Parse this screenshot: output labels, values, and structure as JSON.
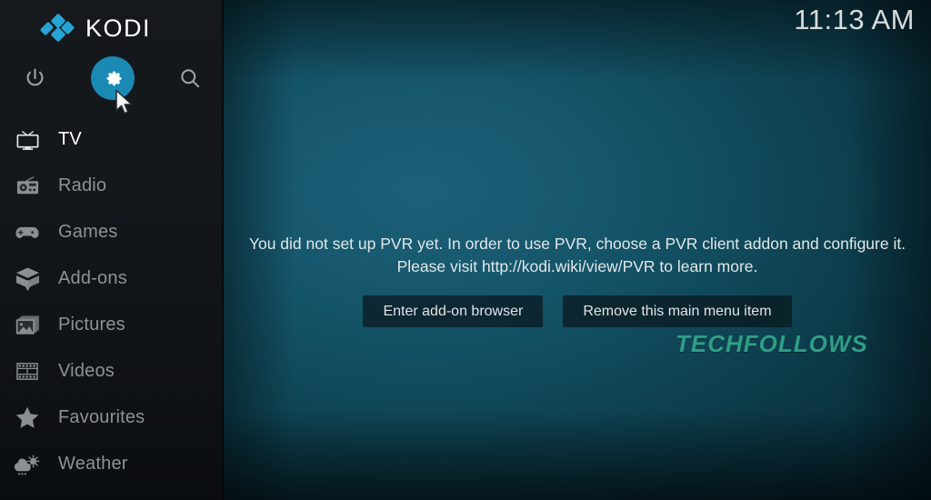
{
  "app": {
    "brand_name": "KODI",
    "brand_color": "#27a3d4",
    "accent_color": "#1a89b4",
    "clock": "11:13 AM"
  },
  "topbar": {
    "icons": [
      {
        "name": "power-icon",
        "label": "Power"
      },
      {
        "name": "settings-gear-icon",
        "label": "Settings",
        "selected": true
      },
      {
        "name": "search-icon",
        "label": "Search"
      }
    ]
  },
  "sidebar": {
    "items": [
      {
        "label": "TV",
        "icon": "tv-icon",
        "selected": true
      },
      {
        "label": "Radio",
        "icon": "radio-icon",
        "selected": false
      },
      {
        "label": "Games",
        "icon": "gamepad-icon",
        "selected": false
      },
      {
        "label": "Add-ons",
        "icon": "addons-box-icon",
        "selected": false
      },
      {
        "label": "Pictures",
        "icon": "pictures-icon",
        "selected": false
      },
      {
        "label": "Videos",
        "icon": "film-strip-icon",
        "selected": false
      },
      {
        "label": "Favourites",
        "icon": "star-icon",
        "selected": false
      },
      {
        "label": "Weather",
        "icon": "weather-icon",
        "selected": false
      }
    ]
  },
  "main": {
    "message_line1": "You did not set up PVR yet. In order to use PVR, choose a PVR client addon and configure it.",
    "message_line2": "Please visit http://kodi.wiki/view/PVR to learn more.",
    "buttons": [
      {
        "label": "Enter add-on browser"
      },
      {
        "label": "Remove this main menu item"
      }
    ],
    "watermark": "TECHFOLLOWS",
    "watermark_color": "#2f9e86"
  }
}
